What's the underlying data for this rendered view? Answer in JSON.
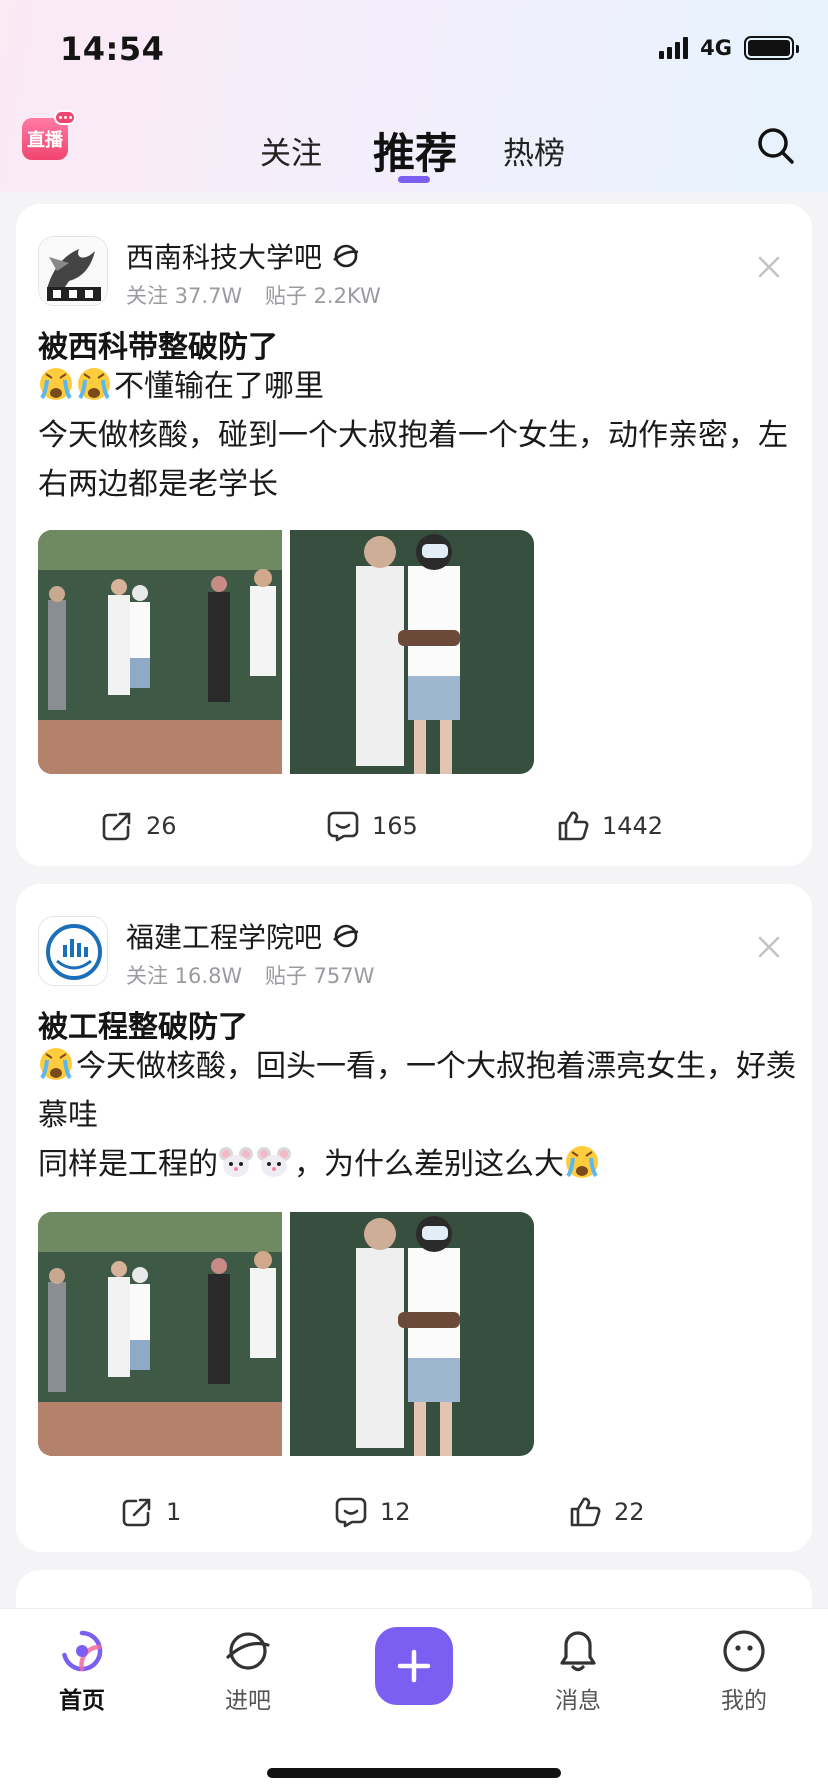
{
  "status_bar": {
    "time": "14:54",
    "network": "4G"
  },
  "header": {
    "live_label": "直播",
    "tabs": [
      {
        "label": "关注",
        "active": false
      },
      {
        "label": "推荐",
        "active": true
      },
      {
        "label": "热榜",
        "active": false
      }
    ],
    "accent_color": "#7b5ff2"
  },
  "feed": {
    "posts": [
      {
        "forum_name": "西南科技大学吧",
        "follow_stat": "关注 37.7W",
        "post_stat": "贴子 2.2KW",
        "title": "被西科带整破防了",
        "lines": [
          "不懂输在了哪里",
          "今天做核酸，碰到一个大叔抱着一个女生，动作亲密，左右两边都是老学长"
        ],
        "emoji_icons": [
          "crying-face-icon",
          "crying-face-icon"
        ],
        "shares": "26",
        "comments": "165",
        "likes": "1442"
      },
      {
        "forum_name": "福建工程学院吧",
        "follow_stat": "关注 16.8W",
        "post_stat": "贴子 757W",
        "title": "被工程整破防了",
        "lines": [
          "今天做核酸，回头一看，一个大叔抱着漂亮女生，好羡慕哇",
          "同样是工程的",
          "，为什么差别这么大"
        ],
        "emoji_icons": [
          "crying-face-icon",
          "mouse-face-icon",
          "mouse-face-icon",
          "crying-face-icon"
        ],
        "shares": "1",
        "comments": "12",
        "likes": "22"
      }
    ]
  },
  "bottom_nav": {
    "items": [
      {
        "label": "首页",
        "active": true
      },
      {
        "label": "进吧",
        "active": false
      },
      {
        "label": "消息",
        "active": false
      },
      {
        "label": "我的",
        "active": false
      }
    ]
  }
}
